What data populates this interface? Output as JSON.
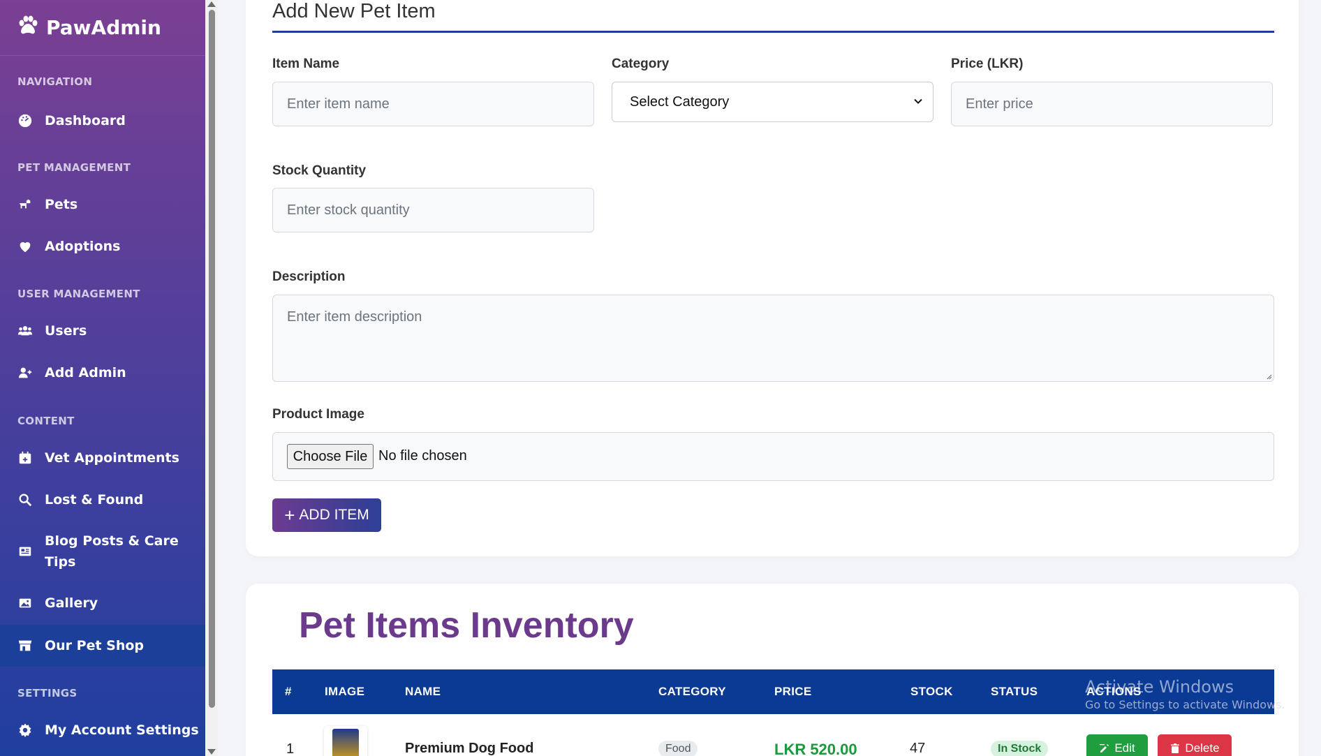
{
  "brand": {
    "name": "PawAdmin"
  },
  "sidebar": {
    "sections": {
      "navigation": "NAVIGATION",
      "pet_management": "PET MANAGEMENT",
      "user_management": "USER MANAGEMENT",
      "content": "CONTENT",
      "settings": "SETTINGS"
    },
    "items": {
      "dashboard": "Dashboard",
      "pets": "Pets",
      "adoptions": "Adoptions",
      "users": "Users",
      "add_admin": "Add Admin",
      "vet_appointments": "Vet Appointments",
      "lost_found": "Lost & Found",
      "blog_line1": "Blog Posts & Care",
      "blog_line2": "Tips",
      "gallery": "Gallery",
      "pet_shop": "Our Pet Shop",
      "account_settings": "My Account Settings"
    },
    "active": "pet_shop"
  },
  "form": {
    "title": "Add New Pet Item",
    "item_name": {
      "label": "Item Name",
      "placeholder": "Enter item name"
    },
    "category": {
      "label": "Category",
      "selected": "Select Category"
    },
    "price": {
      "label": "Price (LKR)",
      "placeholder": "Enter price"
    },
    "stock": {
      "label": "Stock Quantity",
      "placeholder": "Enter stock quantity"
    },
    "description": {
      "label": "Description",
      "placeholder": "Enter item description"
    },
    "image": {
      "label": "Product Image",
      "button": "Choose File",
      "status": "No file chosen"
    },
    "submit": "ADD ITEM"
  },
  "inventory": {
    "title": "Pet Items Inventory",
    "columns": [
      "#",
      "IMAGE",
      "NAME",
      "CATEGORY",
      "PRICE",
      "STOCK",
      "STATUS",
      "ACTIONS"
    ],
    "rows": [
      {
        "index": "1",
        "name": "Premium Dog Food",
        "category": "Food",
        "price": "LKR 520.00",
        "stock": "47",
        "status": "In Stock",
        "edit": "Edit",
        "delete": "Delete"
      }
    ]
  },
  "watermark": {
    "line1": "Activate Windows",
    "line2": "Go to Settings to activate Windows."
  },
  "colors": {
    "primary": "#0b3a94",
    "accent": "#6b3a8c",
    "success": "#1f9d3f",
    "danger": "#dc3545"
  }
}
